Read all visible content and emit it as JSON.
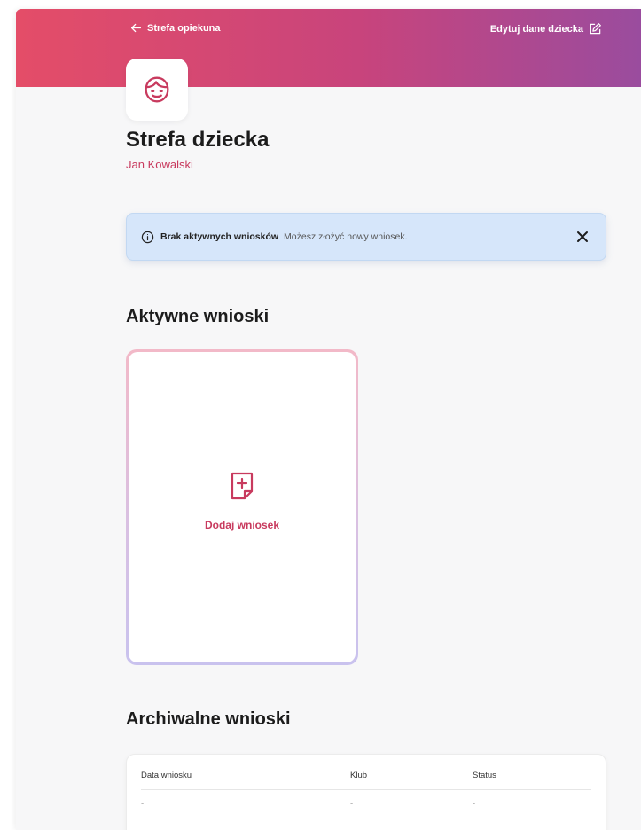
{
  "header": {
    "back_label": "Strefa opiekuna",
    "edit_label": "Edytuj dane dziecka"
  },
  "profile": {
    "title": "Strefa dziecka",
    "child_name": "Jan Kowalski"
  },
  "alert": {
    "title": "Brak aktywnych wniosków",
    "text": "Możesz złożyć nowy wniosek."
  },
  "active": {
    "heading": "Aktywne wnioski",
    "add_label": "Dodaj wniosek"
  },
  "archive": {
    "heading": "Archiwalne wnioski",
    "columns": [
      "Data wniosku",
      "Klub",
      "Status"
    ],
    "rows": [
      [
        "-",
        "-",
        "-"
      ]
    ]
  },
  "colors": {
    "accent": "#c83a5e",
    "header_start": "#e44d68",
    "header_end": "#9a4c9e",
    "alert_bg": "#d6e6fa"
  },
  "icons": {
    "back": "arrow-left-icon",
    "edit": "edit-icon",
    "avatar": "child-face-icon",
    "info": "info-icon",
    "close": "close-icon",
    "add_document": "add-document-icon"
  }
}
